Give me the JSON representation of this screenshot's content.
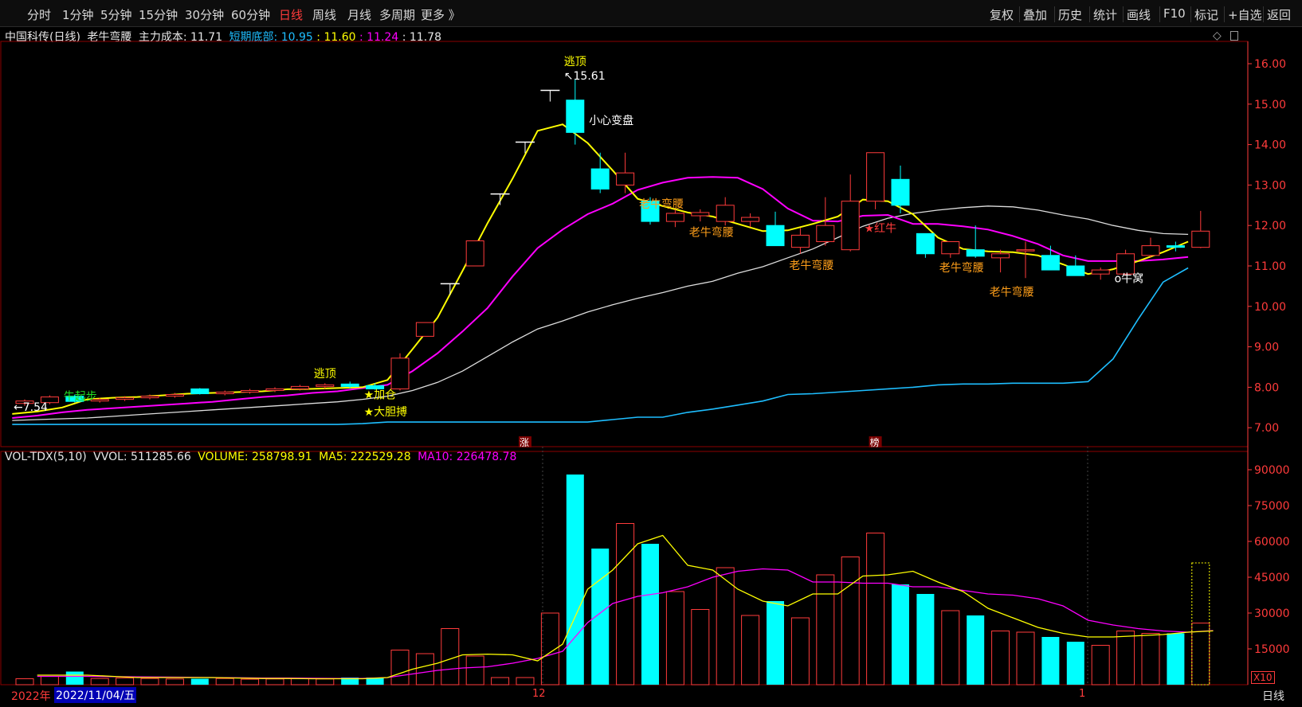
{
  "toolbar": {
    "periods": [
      "分时",
      "1分钟",
      "5分钟",
      "15分钟",
      "30分钟",
      "60分钟",
      "日线",
      "周线",
      "月线",
      "多周期",
      "更多"
    ],
    "active_period": "日线",
    "right_buttons": [
      "复权",
      "叠加",
      "历史",
      "统计",
      "画线",
      "F10",
      "标记",
      "+自选",
      "返回"
    ]
  },
  "info": {
    "stock": "中国科传(日线)",
    "indicator": "老牛弯腰",
    "cost_label": "主力成本:",
    "cost_value": "11.71",
    "bottom_label": "短期底部:",
    "v1": "10.95",
    "v2": "11.60",
    "v3": "11.24",
    "v4": "11.78",
    "sep": ":"
  },
  "vol_info": {
    "name": "VOL-TDX(5,10)",
    "vvol": "VVOL: 511285.66",
    "volume": "VOLUME: 258798.91",
    "ma5": "MA5: 222529.28",
    "ma10": "MA10: 226478.78"
  },
  "dates": {
    "year": "2022年",
    "selected": "2022/11/04/五",
    "month12": "12",
    "month1": "1"
  },
  "period_label": "日线",
  "vol_multiplier": "X10",
  "colors": {
    "up": "#ff3b3b",
    "down": "#00ffff",
    "ma_yellow": "#ffff00",
    "ma_magenta": "#ff00ff",
    "ma_white": "#dddddd",
    "ma_cyan": "#1ebeff",
    "label_orange": "#ff9f1a"
  },
  "chart_data": {
    "type": "candlestick",
    "price_axis": [
      16.0,
      15.0,
      14.0,
      13.0,
      12.0,
      11.0,
      10.0,
      9.0,
      8.0,
      7.0
    ],
    "price_axis_labels": [
      "16.00",
      "15.00",
      "14.00",
      "13.00",
      "12.00",
      "11.00",
      "10.00",
      "9.00",
      "8.00",
      "7.00"
    ],
    "vol_axis": [
      90000,
      75000,
      60000,
      45000,
      30000,
      15000
    ],
    "vol_axis_labels": [
      "90000",
      "75000",
      "60000",
      "45000",
      "30000",
      "15000"
    ],
    "candles": [
      {
        "o": 7.6,
        "h": 7.7,
        "l": 7.54,
        "c": 7.66,
        "v": 2500
      },
      {
        "o": 7.62,
        "h": 7.8,
        "l": 7.58,
        "c": 7.76,
        "v": 3500
      },
      {
        "o": 7.78,
        "h": 7.82,
        "l": 7.62,
        "c": 7.65,
        "v": 5500
      },
      {
        "o": 7.66,
        "h": 7.74,
        "l": 7.62,
        "c": 7.7,
        "v": 2600
      },
      {
        "o": 7.7,
        "h": 7.78,
        "l": 7.66,
        "c": 7.74,
        "v": 2800
      },
      {
        "o": 7.74,
        "h": 7.82,
        "l": 7.7,
        "c": 7.78,
        "v": 2600
      },
      {
        "o": 7.78,
        "h": 7.86,
        "l": 7.74,
        "c": 7.82,
        "v": 2400
      },
      {
        "o": 7.96,
        "h": 7.98,
        "l": 7.82,
        "c": 7.84,
        "v": 2500
      },
      {
        "o": 7.84,
        "h": 7.92,
        "l": 7.8,
        "c": 7.88,
        "v": 2600
      },
      {
        "o": 7.88,
        "h": 7.96,
        "l": 7.84,
        "c": 7.92,
        "v": 2300
      },
      {
        "o": 7.92,
        "h": 8.0,
        "l": 7.88,
        "c": 7.96,
        "v": 2400
      },
      {
        "o": 7.96,
        "h": 8.06,
        "l": 7.92,
        "c": 8.02,
        "v": 2600
      },
      {
        "o": 8.02,
        "h": 8.1,
        "l": 7.96,
        "c": 8.06,
        "v": 2400
      },
      {
        "o": 8.08,
        "h": 8.14,
        "l": 7.98,
        "c": 8.02,
        "v": 3000
      },
      {
        "o": 8.04,
        "h": 8.1,
        "l": 7.94,
        "c": 7.96,
        "v": 3000
      },
      {
        "o": 7.96,
        "h": 8.84,
        "l": 7.92,
        "c": 8.72,
        "v": 14500
      },
      {
        "o": 9.26,
        "h": 9.6,
        "l": 9.26,
        "c": 9.6,
        "v": 13000
      },
      {
        "o": 10.56,
        "h": 10.56,
        "l": 10.56,
        "c": 10.56,
        "v": 23500
      },
      {
        "o": 11.0,
        "h": 11.62,
        "l": 11.0,
        "c": 11.62,
        "v": 12000
      },
      {
        "o": 12.78,
        "h": 12.78,
        "l": 12.78,
        "c": 12.78,
        "v": 3000
      },
      {
        "o": 14.06,
        "h": 14.06,
        "l": 14.06,
        "c": 14.06,
        "v": 3000
      },
      {
        "o": 15.34,
        "h": 15.34,
        "l": 15.34,
        "c": 15.34,
        "v": 30000
      },
      {
        "o": 15.1,
        "h": 15.61,
        "l": 14.0,
        "c": 14.3,
        "v": 88000
      },
      {
        "o": 13.4,
        "h": 13.8,
        "l": 12.8,
        "c": 12.9,
        "v": 57000
      },
      {
        "o": 13.0,
        "h": 13.8,
        "l": 12.8,
        "c": 13.3,
        "v": 67500
      },
      {
        "o": 12.6,
        "h": 12.7,
        "l": 12.02,
        "c": 12.1,
        "v": 59000
      },
      {
        "o": 12.1,
        "h": 12.4,
        "l": 11.96,
        "c": 12.3,
        "v": 39000
      },
      {
        "o": 12.24,
        "h": 12.4,
        "l": 12.1,
        "c": 12.32,
        "v": 31500
      },
      {
        "o": 12.1,
        "h": 12.7,
        "l": 12.0,
        "c": 12.5,
        "v": 49000
      },
      {
        "o": 12.1,
        "h": 12.3,
        "l": 11.96,
        "c": 12.2,
        "v": 29000
      },
      {
        "o": 12.0,
        "h": 12.34,
        "l": 11.5,
        "c": 11.5,
        "v": 35000
      },
      {
        "o": 11.46,
        "h": 11.94,
        "l": 11.3,
        "c": 11.76,
        "v": 28000
      },
      {
        "o": 11.6,
        "h": 12.7,
        "l": 11.5,
        "c": 12.0,
        "v": 46000
      },
      {
        "o": 11.4,
        "h": 13.26,
        "l": 11.36,
        "c": 12.6,
        "v": 53500
      },
      {
        "o": 12.6,
        "h": 13.8,
        "l": 12.4,
        "c": 13.8,
        "v": 63500
      },
      {
        "o": 13.14,
        "h": 13.48,
        "l": 12.3,
        "c": 12.5,
        "v": 42000
      },
      {
        "o": 11.8,
        "h": 11.8,
        "l": 11.2,
        "c": 11.3,
        "v": 38000
      },
      {
        "o": 11.3,
        "h": 11.6,
        "l": 11.2,
        "c": 11.6,
        "v": 31000
      },
      {
        "o": 11.4,
        "h": 12.0,
        "l": 11.2,
        "c": 11.24,
        "v": 29000
      },
      {
        "o": 11.2,
        "h": 11.4,
        "l": 10.84,
        "c": 11.3,
        "v": 22500
      },
      {
        "o": 11.4,
        "h": 11.6,
        "l": 10.7,
        "c": 11.4,
        "v": 22000
      },
      {
        "o": 11.26,
        "h": 11.5,
        "l": 10.9,
        "c": 10.9,
        "v": 20000
      },
      {
        "o": 11.0,
        "h": 11.26,
        "l": 10.76,
        "c": 10.76,
        "v": 18000
      },
      {
        "o": 10.8,
        "h": 10.96,
        "l": 10.66,
        "c": 10.9,
        "v": 16500
      },
      {
        "o": 10.8,
        "h": 11.4,
        "l": 10.76,
        "c": 11.3,
        "v": 22500
      },
      {
        "o": 11.26,
        "h": 11.7,
        "l": 11.2,
        "c": 11.5,
        "v": 21500
      },
      {
        "o": 11.5,
        "h": 11.6,
        "l": 11.36,
        "c": 11.46,
        "v": 21500
      },
      {
        "o": 11.46,
        "h": 12.36,
        "l": 11.44,
        "c": 11.86,
        "v": 25800
      }
    ],
    "vol_partial": 51000,
    "ma_yellow": [
      7.34,
      7.4,
      7.5,
      7.7,
      7.74,
      7.76,
      7.8,
      7.84,
      7.86,
      7.88,
      7.9,
      7.95,
      7.96,
      7.98,
      8.0,
      8.18,
      8.94,
      9.72,
      10.88,
      12.06,
      13.16,
      14.34,
      14.5,
      14.04,
      13.36,
      12.66,
      12.48,
      12.32,
      12.22,
      12.04,
      11.86,
      11.88,
      12.04,
      12.22,
      12.64,
      12.6,
      12.28,
      11.7,
      11.42,
      11.36,
      11.34,
      11.26,
      11.04,
      10.8,
      10.92,
      11.12,
      11.34,
      11.6
    ],
    "ma_magenta": [
      7.24,
      7.3,
      7.38,
      7.44,
      7.48,
      7.52,
      7.56,
      7.6,
      7.64,
      7.7,
      7.76,
      7.8,
      7.86,
      7.9,
      7.98,
      8.06,
      8.4,
      8.84,
      9.38,
      9.96,
      10.74,
      11.44,
      11.9,
      12.28,
      12.54,
      12.88,
      13.06,
      13.18,
      13.2,
      13.18,
      12.9,
      12.42,
      12.12,
      12.1,
      12.24,
      12.26,
      12.04,
      12.04,
      11.98,
      11.9,
      11.74,
      11.54,
      11.26,
      11.12,
      11.12,
      11.12,
      11.16,
      11.22
    ],
    "ma_white": [
      7.18,
      7.2,
      7.22,
      7.24,
      7.28,
      7.32,
      7.36,
      7.4,
      7.44,
      7.48,
      7.52,
      7.56,
      7.6,
      7.64,
      7.7,
      7.78,
      7.92,
      8.12,
      8.4,
      8.76,
      9.12,
      9.44,
      9.64,
      9.86,
      10.04,
      10.2,
      10.34,
      10.5,
      10.62,
      10.82,
      10.98,
      11.2,
      11.42,
      11.7,
      11.98,
      12.18,
      12.3,
      12.38,
      12.44,
      12.48,
      12.46,
      12.38,
      12.26,
      12.16,
      12.0,
      11.88,
      11.8,
      11.78
    ],
    "ma_cyan": [
      7.08,
      7.08,
      7.08,
      7.08,
      7.08,
      7.08,
      7.08,
      7.08,
      7.08,
      7.08,
      7.08,
      7.08,
      7.08,
      7.08,
      7.1,
      7.14,
      7.14,
      7.14,
      7.14,
      7.14,
      7.14,
      7.14,
      7.14,
      7.14,
      7.2,
      7.26,
      7.26,
      7.38,
      7.46,
      7.56,
      7.66,
      7.82,
      7.84,
      7.88,
      7.92,
      7.96,
      8.0,
      8.06,
      8.08,
      8.08,
      8.1,
      8.1,
      8.1,
      8.14,
      8.7,
      9.68,
      10.6,
      10.95
    ],
    "vol_ma5": [
      4000,
      4000,
      4000,
      3500,
      3000,
      3000,
      3000,
      3000,
      2800,
      2600,
      2600,
      2500,
      2500,
      2500,
      3000,
      6500,
      9000,
      12500,
      12800,
      12500,
      10000,
      17000,
      40000,
      48000,
      59000,
      62500,
      50000,
      48000,
      40000,
      35000,
      33000,
      38000,
      38000,
      45500,
      46000,
      47500,
      43000,
      39000,
      32000,
      28000,
      24000,
      21500,
      20000,
      20000,
      20500,
      21000,
      22000,
      22530
    ],
    "vol_ma10": [
      3500,
      3500,
      3500,
      3400,
      3300,
      3200,
      3100,
      3000,
      2900,
      2800,
      2800,
      2700,
      2600,
      2600,
      3000,
      4500,
      6000,
      7000,
      7500,
      9000,
      11000,
      14000,
      26000,
      34000,
      37000,
      38500,
      41000,
      45000,
      47500,
      48500,
      48000,
      43000,
      43000,
      42500,
      42500,
      41000,
      41000,
      39500,
      38000,
      37500,
      36000,
      33000,
      27000,
      25000,
      23500,
      22500,
      22000,
      22650
    ],
    "annotations": [
      {
        "text": "逃顶",
        "idx": 22,
        "price": 15.96,
        "color": "#ffff00"
      },
      {
        "text": "15.61",
        "idx": 22,
        "price": 15.61,
        "color": "#ffffff",
        "prefix": "↖"
      },
      {
        "text": "小心变盘",
        "idx": 23,
        "price": 14.5,
        "color": "#ffffff"
      },
      {
        "text": "逃顶",
        "idx": 12,
        "price": 8.24,
        "color": "#ffff00"
      },
      {
        "text": "老牛弯腰",
        "idx": 25,
        "price": 12.44,
        "color": "#ff9f1a"
      },
      {
        "text": "老牛弯腰",
        "idx": 27,
        "price": 11.74,
        "color": "#ff9f1a"
      },
      {
        "text": "老牛弯腰",
        "idx": 31,
        "price": 10.92,
        "color": "#ff9f1a"
      },
      {
        "text": "老牛弯腰",
        "idx": 37,
        "price": 10.86,
        "color": "#ff9f1a"
      },
      {
        "text": "老牛弯腰",
        "idx": 39,
        "price": 10.26,
        "color": "#ff9f1a"
      },
      {
        "text": "★红牛",
        "idx": 34,
        "price": 11.84,
        "color": "#ff3b3b"
      },
      {
        "text": "o牛窝",
        "idx": 44,
        "price": 10.6,
        "color": "#ffffff"
      },
      {
        "text": "★加仓",
        "idx": 14,
        "price": 7.72,
        "color": "#ffff00"
      },
      {
        "text": "★大胆搏",
        "idx": 14,
        "price": 7.3,
        "color": "#ffff00"
      },
      {
        "text": "←7.54",
        "idx": 0,
        "price": 7.42,
        "color": "#ffffff"
      },
      {
        "text": "牛起步",
        "idx": 2,
        "price": 7.68,
        "color": "#22dd22"
      }
    ],
    "special_markers": [
      {
        "text": "涨",
        "idx": 20
      },
      {
        "text": "榜",
        "idx": 34
      }
    ]
  }
}
